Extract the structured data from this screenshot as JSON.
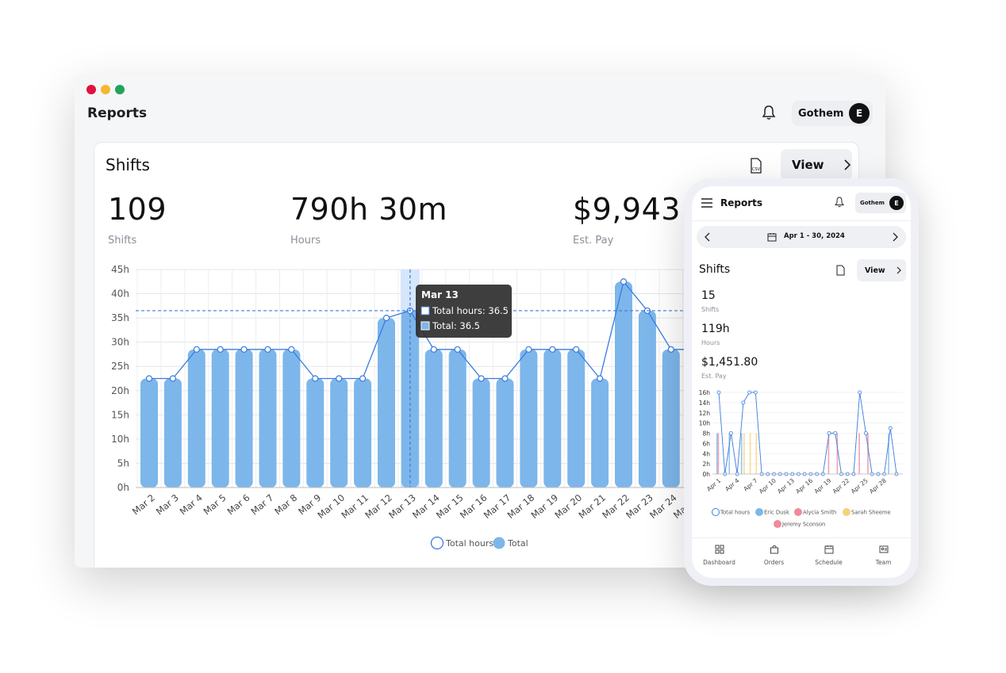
{
  "window": {
    "title": "Reports",
    "user": "Gothem",
    "avatar_letter": "E",
    "traffic": [
      "#e0123f",
      "#f5b731",
      "#21a35a"
    ]
  },
  "shifts_card": {
    "title": "Shifts",
    "view_label": "View",
    "stats": [
      {
        "value": "109",
        "label": "Shifts"
      },
      {
        "value": "790h 30m",
        "label": "Hours"
      },
      {
        "value": "$9,943.0",
        "label": "Est. Pay"
      }
    ],
    "tooltip": {
      "title": "Mar 13",
      "line1": "Total hours: 36.5",
      "line2": "Total: 36.5"
    },
    "legend": [
      "Total hours",
      "Total"
    ]
  },
  "chart_data": [
    {
      "type": "bar",
      "categories": [
        "Mar 2",
        "Mar 3",
        "Mar 4",
        "Mar 5",
        "Mar 6",
        "Mar 7",
        "Mar 8",
        "Mar 9",
        "Mar 10",
        "Mar 11",
        "Mar 12",
        "Mar 13",
        "Mar 14",
        "Mar 15",
        "Mar 16",
        "Mar 17",
        "Mar 18",
        "Mar 19",
        "Mar 20",
        "Mar 21",
        "Mar 22",
        "Mar 23",
        "Mar 24",
        "Mar 25"
      ],
      "series": [
        {
          "name": "Total hours",
          "type": "line",
          "values": [
            22.5,
            22.5,
            28.5,
            28.5,
            28.5,
            28.5,
            28.5,
            22.5,
            22.5,
            22.5,
            35,
            36.5,
            28.5,
            28.5,
            22.5,
            22.5,
            28.5,
            28.5,
            28.5,
            22.5,
            42.5,
            36.5,
            28.5,
            28.5
          ]
        },
        {
          "name": "Total",
          "type": "bar",
          "values": [
            22.5,
            22.5,
            28.5,
            28.5,
            28.5,
            28.5,
            28.5,
            22.5,
            22.5,
            22.5,
            35,
            36.5,
            28.5,
            28.5,
            22.5,
            22.5,
            28.5,
            28.5,
            28.5,
            22.5,
            42.5,
            36.5,
            28.5,
            28.5
          ]
        }
      ],
      "y_ticks": [
        "0h",
        "5h",
        "10h",
        "15h",
        "20h",
        "25h",
        "30h",
        "35h",
        "40h",
        "45h"
      ],
      "ylim": [
        0,
        45
      ],
      "grid": true,
      "colors": {
        "bar": "#7db6ea",
        "line": "#3a7be0",
        "highlight": "#d6e6fb"
      }
    },
    {
      "type": "line",
      "categories": [
        "Apr 1",
        "Apr 2",
        "Apr 3",
        "Apr 4",
        "Apr 5",
        "Apr 6",
        "Apr 7",
        "Apr 8",
        "Apr 9",
        "Apr 10",
        "Apr 11",
        "Apr 12",
        "Apr 13",
        "Apr 14",
        "Apr 15",
        "Apr 16",
        "Apr 17",
        "Apr 18",
        "Apr 19",
        "Apr 20",
        "Apr 21",
        "Apr 22",
        "Apr 23",
        "Apr 24",
        "Apr 25",
        "Apr 26",
        "Apr 27",
        "Apr 28",
        "Apr 29",
        "Apr 30"
      ],
      "x_tick_labels": [
        "Apr 1",
        "Apr 4",
        "Apr 7",
        "Apr 10",
        "Apr 13",
        "Apr 16",
        "Apr 19",
        "Apr 22",
        "Apr 25",
        "Apr 28"
      ],
      "series": [
        {
          "name": "Total hours",
          "values": [
            16,
            0,
            8,
            0,
            14,
            16,
            16,
            0,
            0,
            0,
            0,
            0,
            0,
            0,
            0,
            0,
            0,
            0,
            8,
            8,
            0,
            0,
            0,
            16,
            8,
            0,
            0,
            0,
            9,
            0
          ]
        },
        {
          "name": "Eric Dusk",
          "values": [
            8,
            0,
            8,
            0,
            8,
            0,
            0,
            0,
            0,
            0,
            0,
            0,
            0,
            0,
            0,
            0,
            0,
            0,
            0,
            0,
            0,
            0,
            0,
            0,
            0,
            0,
            0,
            0,
            8,
            0
          ]
        },
        {
          "name": "Alycia Smith",
          "values": [
            8,
            0,
            0,
            0,
            0,
            0,
            0,
            0,
            0,
            0,
            0,
            0,
            0,
            0,
            0,
            0,
            0,
            0,
            8,
            0,
            0,
            0,
            0,
            8,
            0,
            0,
            0,
            0,
            0,
            0
          ]
        },
        {
          "name": "Sarah Sheeme",
          "values": [
            0,
            0,
            0,
            0,
            8,
            8,
            8,
            0,
            0,
            0,
            0,
            0,
            0,
            0,
            0,
            0,
            0,
            0,
            0,
            0,
            0,
            0,
            0,
            0,
            0,
            0,
            0,
            0,
            0,
            0
          ]
        },
        {
          "name": "Jeremy Sconson",
          "values": [
            0,
            0,
            0,
            0,
            0,
            0,
            0,
            0,
            0,
            0,
            0,
            0,
            0,
            0,
            0,
            0,
            0,
            0,
            0,
            8,
            0,
            0,
            0,
            0,
            8,
            0,
            0,
            0,
            0,
            0
          ]
        }
      ],
      "y_ticks": [
        "0h",
        "2h",
        "4h",
        "6h",
        "8h",
        "10h",
        "12h",
        "14h",
        "16h"
      ],
      "ylim": [
        0,
        16
      ],
      "grid": true,
      "colors": {
        "Total hours": "#3a7be0",
        "Eric Dusk": "#7db6ea",
        "Alycia Smith": "#f08a9c",
        "Sarah Sheeme": "#f7d27a",
        "Jeremy Sconson": "#f08a9c"
      }
    }
  ],
  "phone": {
    "title": "Reports",
    "user": "Gothem",
    "avatar_letter": "E",
    "date_range": "Apr 1 - 30, 2024",
    "card_title": "Shifts",
    "view_label": "View",
    "stats": [
      {
        "value": "15",
        "label": "Shifts"
      },
      {
        "value": "119h",
        "label": "Hours"
      },
      {
        "value": "$1,451.80",
        "label": "Est. Pay"
      }
    ],
    "legend": [
      "Total hours",
      "Eric Dusk",
      "Alycia Smith",
      "Sarah Sheeme",
      "Jeremy Sconson"
    ],
    "nav": [
      {
        "label": "Dashboard",
        "icon": "dashboard-icon"
      },
      {
        "label": "Orders",
        "icon": "bag-icon"
      },
      {
        "label": "Schedule",
        "icon": "calendar-icon"
      },
      {
        "label": "Team",
        "icon": "id-card-icon"
      }
    ]
  }
}
